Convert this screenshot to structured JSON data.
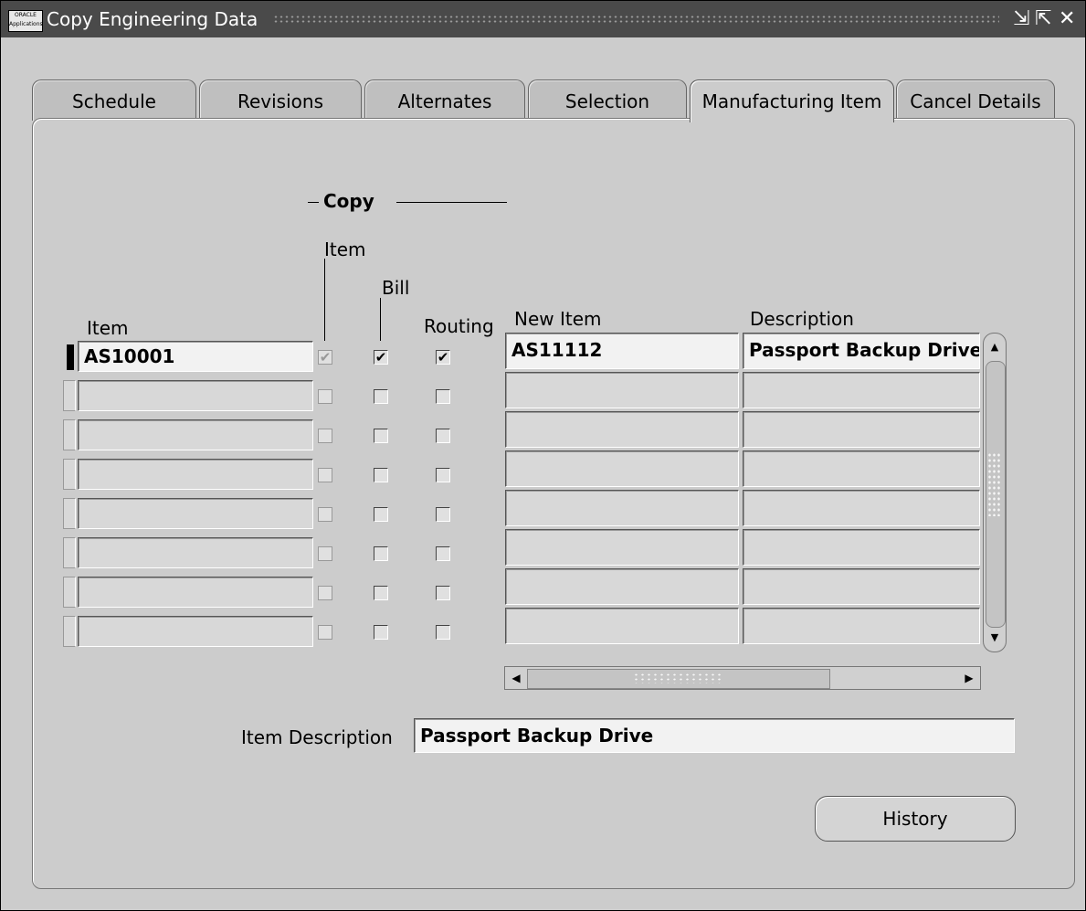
{
  "window": {
    "title": "Copy Engineering Data",
    "logo_text": "ORACLE Applications"
  },
  "tabs": [
    "Schedule",
    "Revisions",
    "Alternates",
    "Selection",
    "Manufacturing Item",
    "Cancel Details"
  ],
  "active_tab": "Manufacturing Item",
  "copy_group": {
    "label": "Copy",
    "col_item": "Item",
    "col_bill": "Bill",
    "col_routing": "Routing"
  },
  "columns": {
    "item": "Item",
    "new_item": "New Item",
    "description": "Description"
  },
  "rows": [
    {
      "item": "AS10001",
      "copy_item": true,
      "copy_bill": true,
      "copy_routing": true,
      "new_item": "AS11112",
      "description": "Passport Backup Drive"
    },
    {
      "item": "",
      "copy_item": false,
      "copy_bill": false,
      "copy_routing": false,
      "new_item": "",
      "description": ""
    },
    {
      "item": "",
      "copy_item": false,
      "copy_bill": false,
      "copy_routing": false,
      "new_item": "",
      "description": ""
    },
    {
      "item": "",
      "copy_item": false,
      "copy_bill": false,
      "copy_routing": false,
      "new_item": "",
      "description": ""
    },
    {
      "item": "",
      "copy_item": false,
      "copy_bill": false,
      "copy_routing": false,
      "new_item": "",
      "description": ""
    },
    {
      "item": "",
      "copy_item": false,
      "copy_bill": false,
      "copy_routing": false,
      "new_item": "",
      "description": ""
    },
    {
      "item": "",
      "copy_item": false,
      "copy_bill": false,
      "copy_routing": false,
      "new_item": "",
      "description": ""
    },
    {
      "item": "",
      "copy_item": false,
      "copy_bill": false,
      "copy_routing": false,
      "new_item": "",
      "description": ""
    }
  ],
  "item_description": {
    "label": "Item Description",
    "value": "Passport Backup Drive"
  },
  "buttons": {
    "history": "History"
  },
  "check_glyph": "✔"
}
